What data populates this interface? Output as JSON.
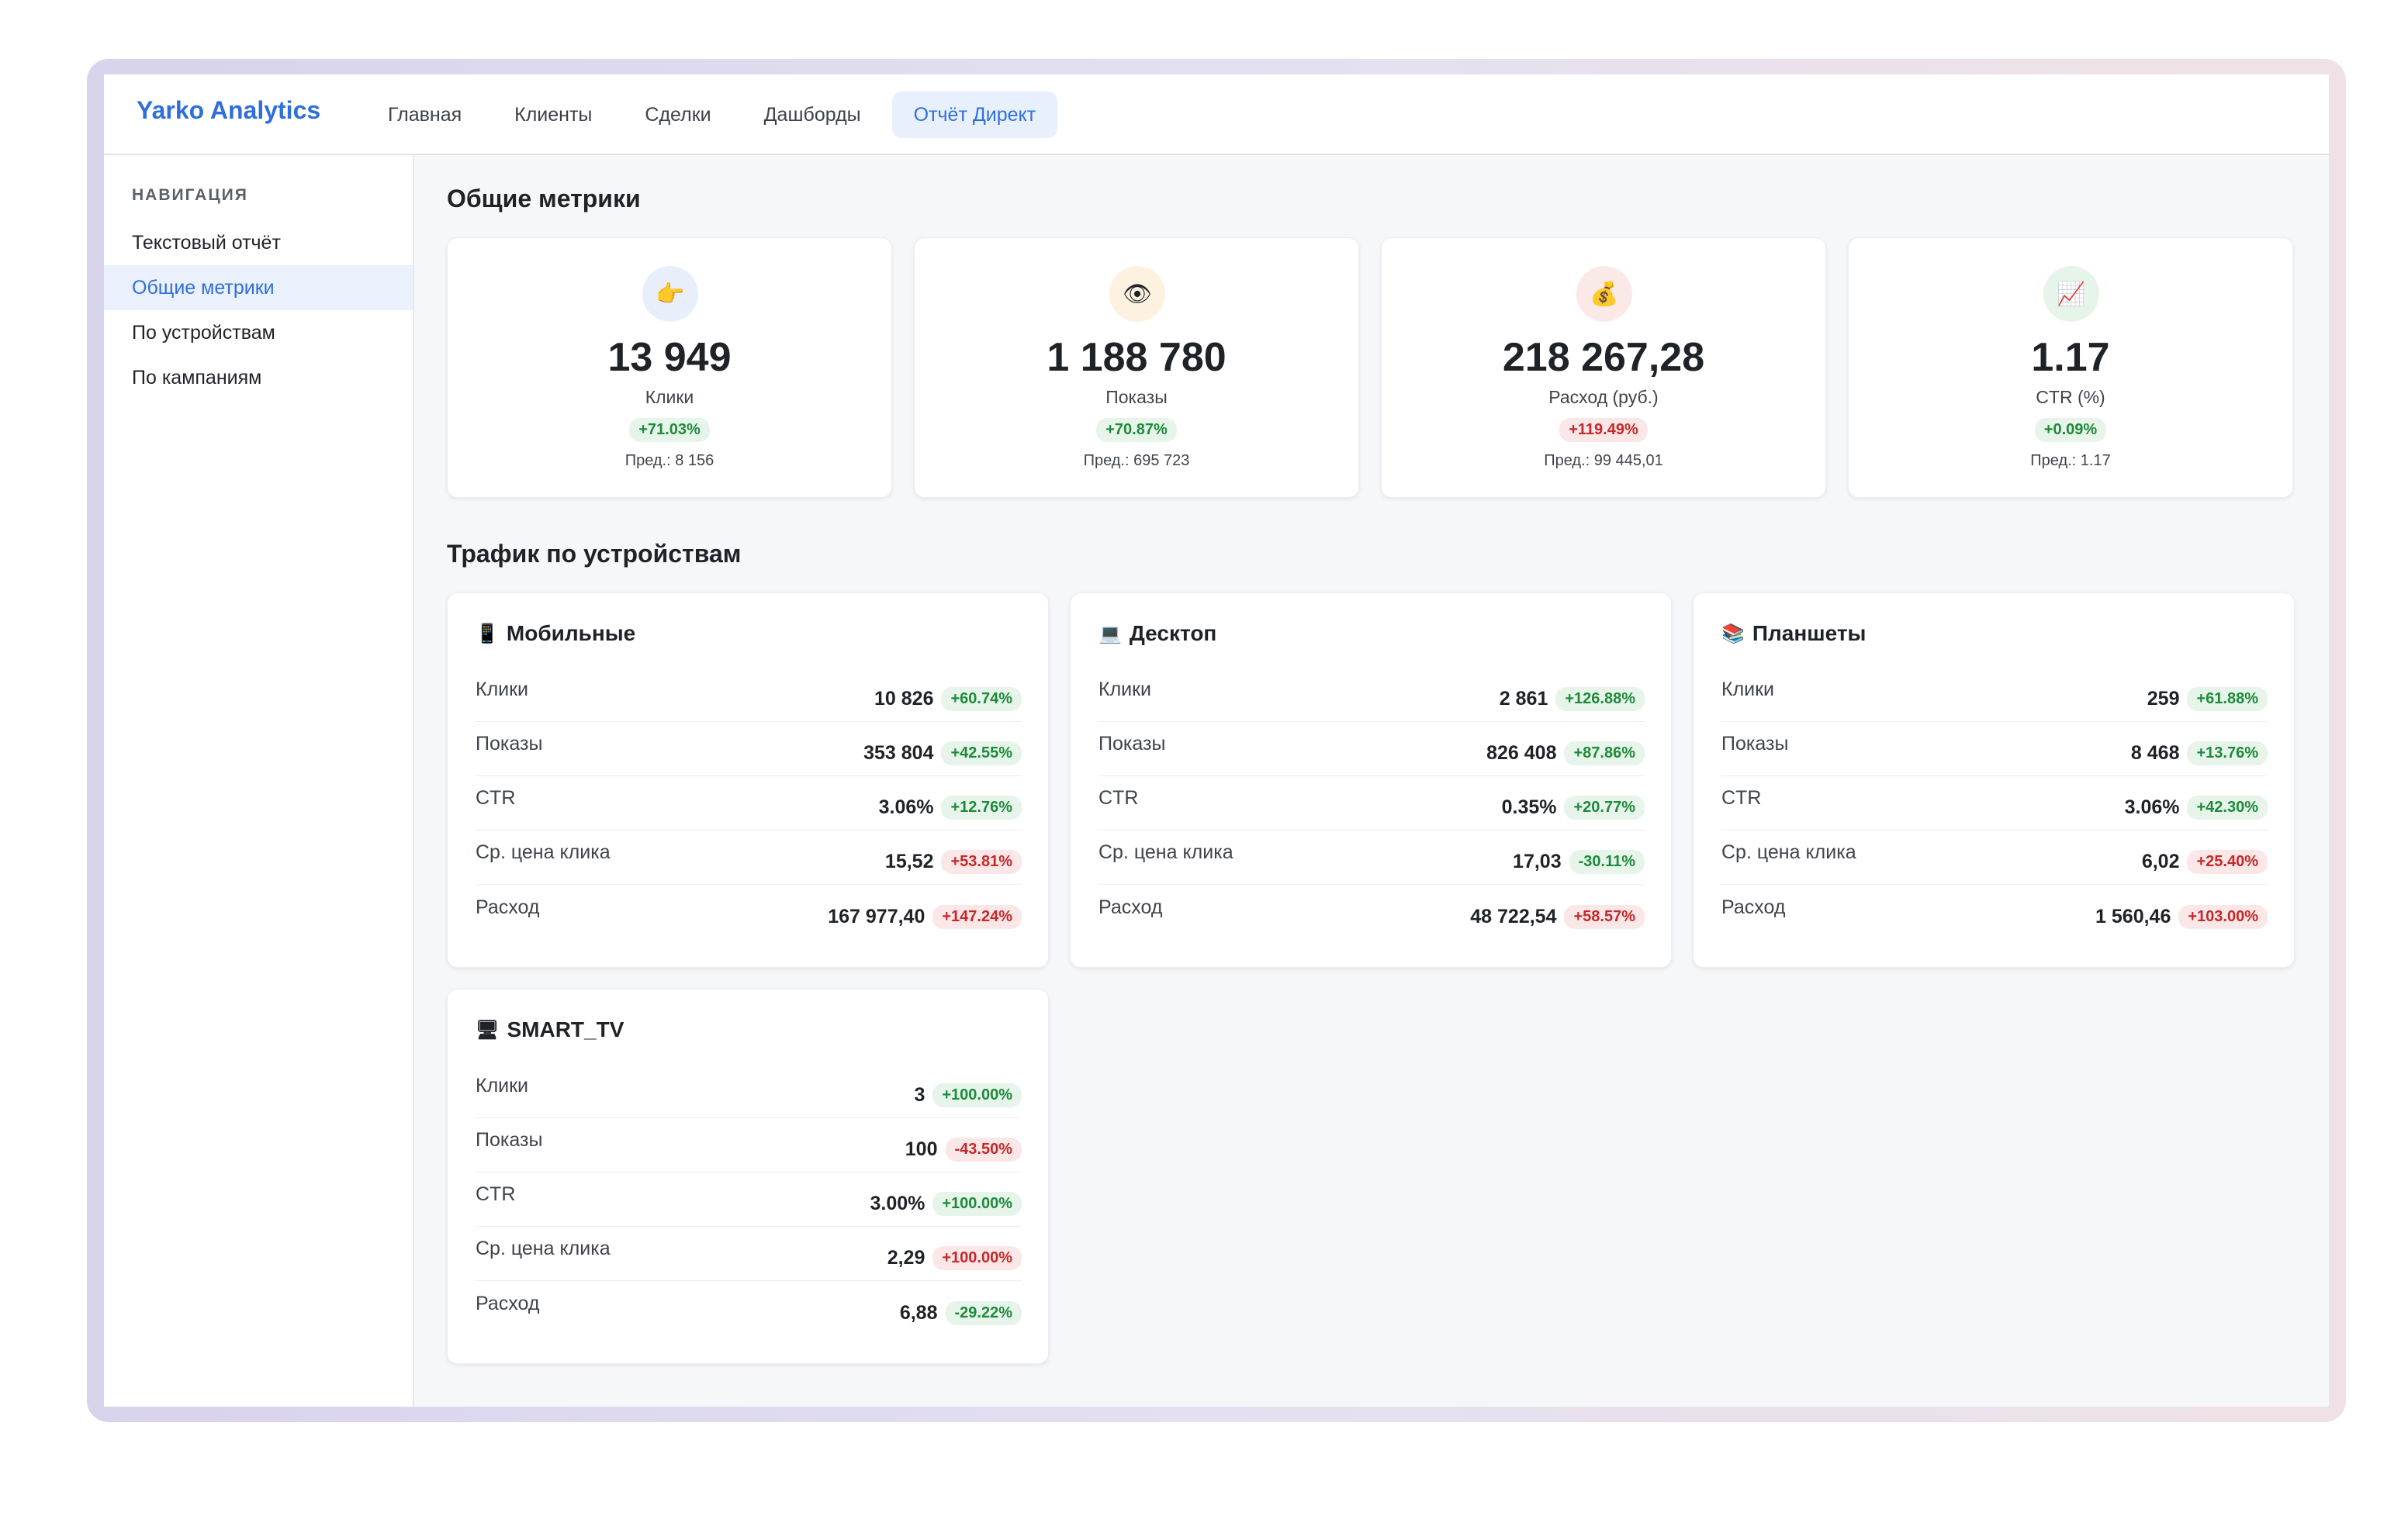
{
  "app": {
    "brand": "Yarko Analytics",
    "tabs": [
      {
        "label": "Главная"
      },
      {
        "label": "Клиенты"
      },
      {
        "label": "Сделки"
      },
      {
        "label": "Дашборды"
      },
      {
        "label": "Отчёт Директ"
      }
    ],
    "active_tab": "Отчёт Директ"
  },
  "sidebar": {
    "heading": "НАВИГАЦИЯ",
    "items": [
      {
        "label": "Текстовый отчёт"
      },
      {
        "label": "Общие метрики"
      },
      {
        "label": "По устройствам"
      },
      {
        "label": "По кампаниям"
      }
    ],
    "active_item": "Общие метрики"
  },
  "overview": {
    "title": "Общие метрики",
    "cards": [
      {
        "icon": "pointing-hand-icon",
        "glyph": "👉",
        "value": "13 949",
        "label": "Клики",
        "change": "+71.03%",
        "trend": "up",
        "prev": "Пред.: 8 156",
        "icon_bg": "#e8effb"
      },
      {
        "icon": "eye-icon",
        "glyph": "👁",
        "value": "1 188 780",
        "label": "Показы",
        "change": "+70.87%",
        "trend": "up",
        "prev": "Пред.: 695 723",
        "icon_bg": "#fdf2df"
      },
      {
        "icon": "money-bag-icon",
        "glyph": "💰",
        "value": "218 267,28",
        "label": "Расход (руб.)",
        "change": "+119.49%",
        "trend": "down",
        "prev": "Пред.: 99 445,01",
        "icon_bg": "#fbe9e7"
      },
      {
        "icon": "chart-up-icon",
        "glyph": "📈",
        "value": "1.17",
        "label": "CTR (%)",
        "change": "+0.09%",
        "trend": "up",
        "prev": "Пред.: 1.17",
        "icon_bg": "#e7f4ea"
      }
    ]
  },
  "devices": {
    "title": "Трафик по устройствам",
    "cards": [
      {
        "icon": "mobile-phone-icon",
        "glyph": "📱",
        "name": "Мобильные",
        "rows": [
          {
            "label": "Клики",
            "value": "10 826",
            "change": "+60.74%",
            "trend": "up"
          },
          {
            "label": "Показы",
            "value": "353 804",
            "change": "+42.55%",
            "trend": "up"
          },
          {
            "label": "CTR",
            "value": "3.06%",
            "change": "+12.76%",
            "trend": "up"
          },
          {
            "label": "Ср. цена клика",
            "value": "15,52",
            "change": "+53.81%",
            "trend": "down"
          },
          {
            "label": "Расход",
            "value": "167 977,40",
            "change": "+147.24%",
            "trend": "down"
          }
        ]
      },
      {
        "icon": "laptop-icon",
        "glyph": "💻",
        "name": "Десктоп",
        "rows": [
          {
            "label": "Клики",
            "value": "2 861",
            "change": "+126.88%",
            "trend": "up"
          },
          {
            "label": "Показы",
            "value": "826 408",
            "change": "+87.86%",
            "trend": "up"
          },
          {
            "label": "CTR",
            "value": "0.35%",
            "change": "+20.77%",
            "trend": "up"
          },
          {
            "label": "Ср. цена клика",
            "value": "17,03",
            "change": "-30.11%",
            "trend": "up"
          },
          {
            "label": "Расход",
            "value": "48 722,54",
            "change": "+58.57%",
            "trend": "down"
          }
        ]
      },
      {
        "icon": "books-icon",
        "glyph": "📚",
        "name": "Планшеты",
        "rows": [
          {
            "label": "Клики",
            "value": "259",
            "change": "+61.88%",
            "trend": "up"
          },
          {
            "label": "Показы",
            "value": "8 468",
            "change": "+13.76%",
            "trend": "up"
          },
          {
            "label": "CTR",
            "value": "3.06%",
            "change": "+42.30%",
            "trend": "up"
          },
          {
            "label": "Ср. цена клика",
            "value": "6,02",
            "change": "+25.40%",
            "trend": "down"
          },
          {
            "label": "Расход",
            "value": "1 560,46",
            "change": "+103.00%",
            "trend": "down"
          }
        ]
      },
      {
        "icon": "tv-monitor-icon",
        "glyph": "🖥",
        "name": "SMART_TV",
        "rows": [
          {
            "label": "Клики",
            "value": "3",
            "change": "+100.00%",
            "trend": "up"
          },
          {
            "label": "Показы",
            "value": "100",
            "change": "-43.50%",
            "trend": "down"
          },
          {
            "label": "CTR",
            "value": "3.00%",
            "change": "+100.00%",
            "trend": "up"
          },
          {
            "label": "Ср. цена клика",
            "value": "2,29",
            "change": "+100.00%",
            "trend": "down"
          },
          {
            "label": "Расход",
            "value": "6,88",
            "change": "-29.22%",
            "trend": "up"
          }
        ]
      }
    ]
  },
  "colors": {
    "accent": "#2f6fdd",
    "positive": "#1e8a3a",
    "negative": "#c62828"
  }
}
